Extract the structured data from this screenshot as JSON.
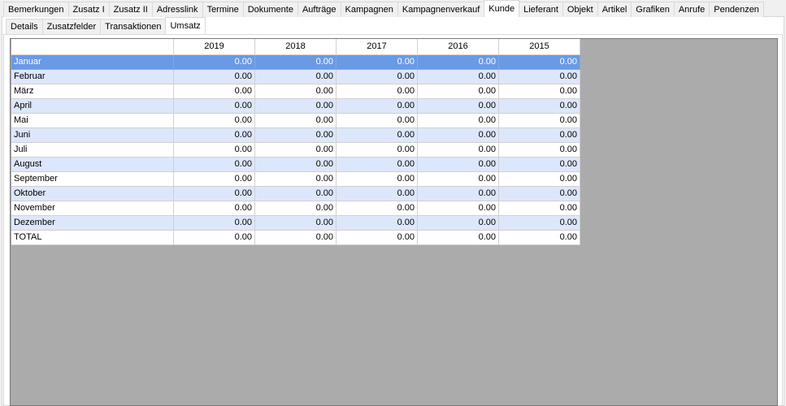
{
  "tabs_main": [
    {
      "label": "Bemerkungen",
      "active": false
    },
    {
      "label": "Zusatz I",
      "active": false
    },
    {
      "label": "Zusatz II",
      "active": false
    },
    {
      "label": "Adresslink",
      "active": false
    },
    {
      "label": "Termine",
      "active": false
    },
    {
      "label": "Dokumente",
      "active": false
    },
    {
      "label": "Aufträge",
      "active": false
    },
    {
      "label": "Kampagnen",
      "active": false
    },
    {
      "label": "Kampagnenverkauf",
      "active": false
    },
    {
      "label": "Kunde",
      "active": true
    },
    {
      "label": "Lieferant",
      "active": false
    },
    {
      "label": "Objekt",
      "active": false
    },
    {
      "label": "Artikel",
      "active": false
    },
    {
      "label": "Grafiken",
      "active": false
    },
    {
      "label": "Anrufe",
      "active": false
    },
    {
      "label": "Pendenzen",
      "active": false
    }
  ],
  "tabs_sub": [
    {
      "label": "Details",
      "active": false
    },
    {
      "label": "Zusatzfelder",
      "active": false
    },
    {
      "label": "Transaktionen",
      "active": false
    },
    {
      "label": "Umsatz",
      "active": true
    }
  ],
  "table": {
    "columns": [
      "",
      "2019",
      "2018",
      "2017",
      "2016",
      "2015"
    ],
    "selected_row": 0,
    "rows": [
      {
        "label": "Januar",
        "values": [
          "0.00",
          "0.00",
          "0.00",
          "0.00",
          "0.00"
        ]
      },
      {
        "label": "Februar",
        "values": [
          "0.00",
          "0.00",
          "0.00",
          "0.00",
          "0.00"
        ]
      },
      {
        "label": "März",
        "values": [
          "0.00",
          "0.00",
          "0.00",
          "0.00",
          "0.00"
        ]
      },
      {
        "label": "April",
        "values": [
          "0.00",
          "0.00",
          "0.00",
          "0.00",
          "0.00"
        ]
      },
      {
        "label": "Mai",
        "values": [
          "0.00",
          "0.00",
          "0.00",
          "0.00",
          "0.00"
        ]
      },
      {
        "label": "Juni",
        "values": [
          "0.00",
          "0.00",
          "0.00",
          "0.00",
          "0.00"
        ]
      },
      {
        "label": "Juli",
        "values": [
          "0.00",
          "0.00",
          "0.00",
          "0.00",
          "0.00"
        ]
      },
      {
        "label": "August",
        "values": [
          "0.00",
          "0.00",
          "0.00",
          "0.00",
          "0.00"
        ]
      },
      {
        "label": "September",
        "values": [
          "0.00",
          "0.00",
          "0.00",
          "0.00",
          "0.00"
        ]
      },
      {
        "label": "Oktober",
        "values": [
          "0.00",
          "0.00",
          "0.00",
          "0.00",
          "0.00"
        ]
      },
      {
        "label": "November",
        "values": [
          "0.00",
          "0.00",
          "0.00",
          "0.00",
          "0.00"
        ]
      },
      {
        "label": "Dezember",
        "values": [
          "0.00",
          "0.00",
          "0.00",
          "0.00",
          "0.00"
        ]
      },
      {
        "label": "TOTAL",
        "values": [
          "0.00",
          "0.00",
          "0.00",
          "0.00",
          "0.00"
        ]
      }
    ]
  },
  "colors": {
    "selected_row": "#6a9ae6",
    "alt_row": "#dde7fb",
    "grid_background": "#ababab"
  }
}
